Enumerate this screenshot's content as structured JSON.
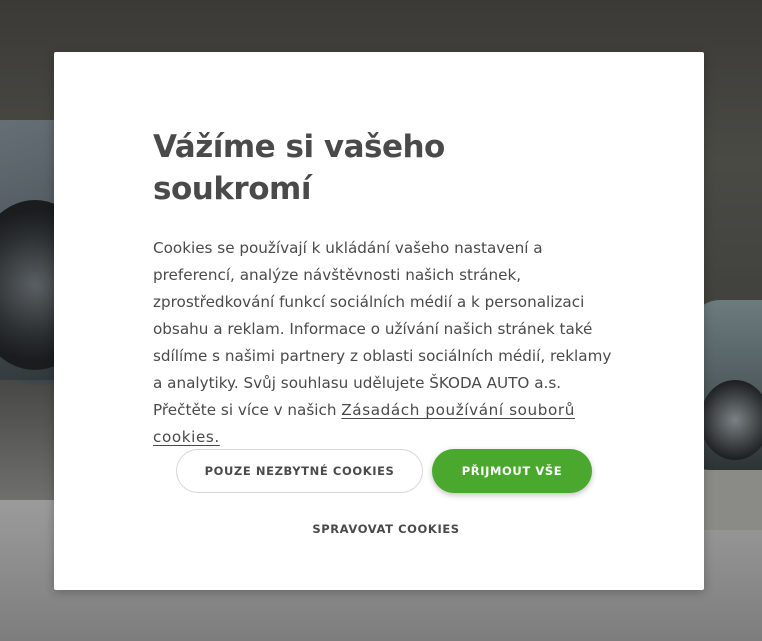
{
  "modal": {
    "title": "Vážíme si vašeho soukromí",
    "body_text": "Cookies se používají k ukládání vašeho nastavení a preferencí, analýze návštěvnosti našich stránek, zprostředkování funkcí sociálních médií a k personalizaci obsahu a reklam. Informace o užívání našich stránek také sdílíme s našimi partnery z oblasti sociálních médií, reklamy a analytiky. Svůj souhlasu udělujete ŠKODA AUTO a.s. Přečtěte si více v našich ",
    "policy_link": "Zásadách používání souborů cookies.",
    "buttons": {
      "necessary_only": "POUZE NEZBYTNÉ COOKIES",
      "accept_all": "PŘIJMOUT VŠE",
      "manage": "SPRAVOVAT COOKIES"
    }
  },
  "colors": {
    "accent_green": "#4ba82e",
    "text": "#4a4a4a",
    "modal_bg": "#ffffff"
  }
}
